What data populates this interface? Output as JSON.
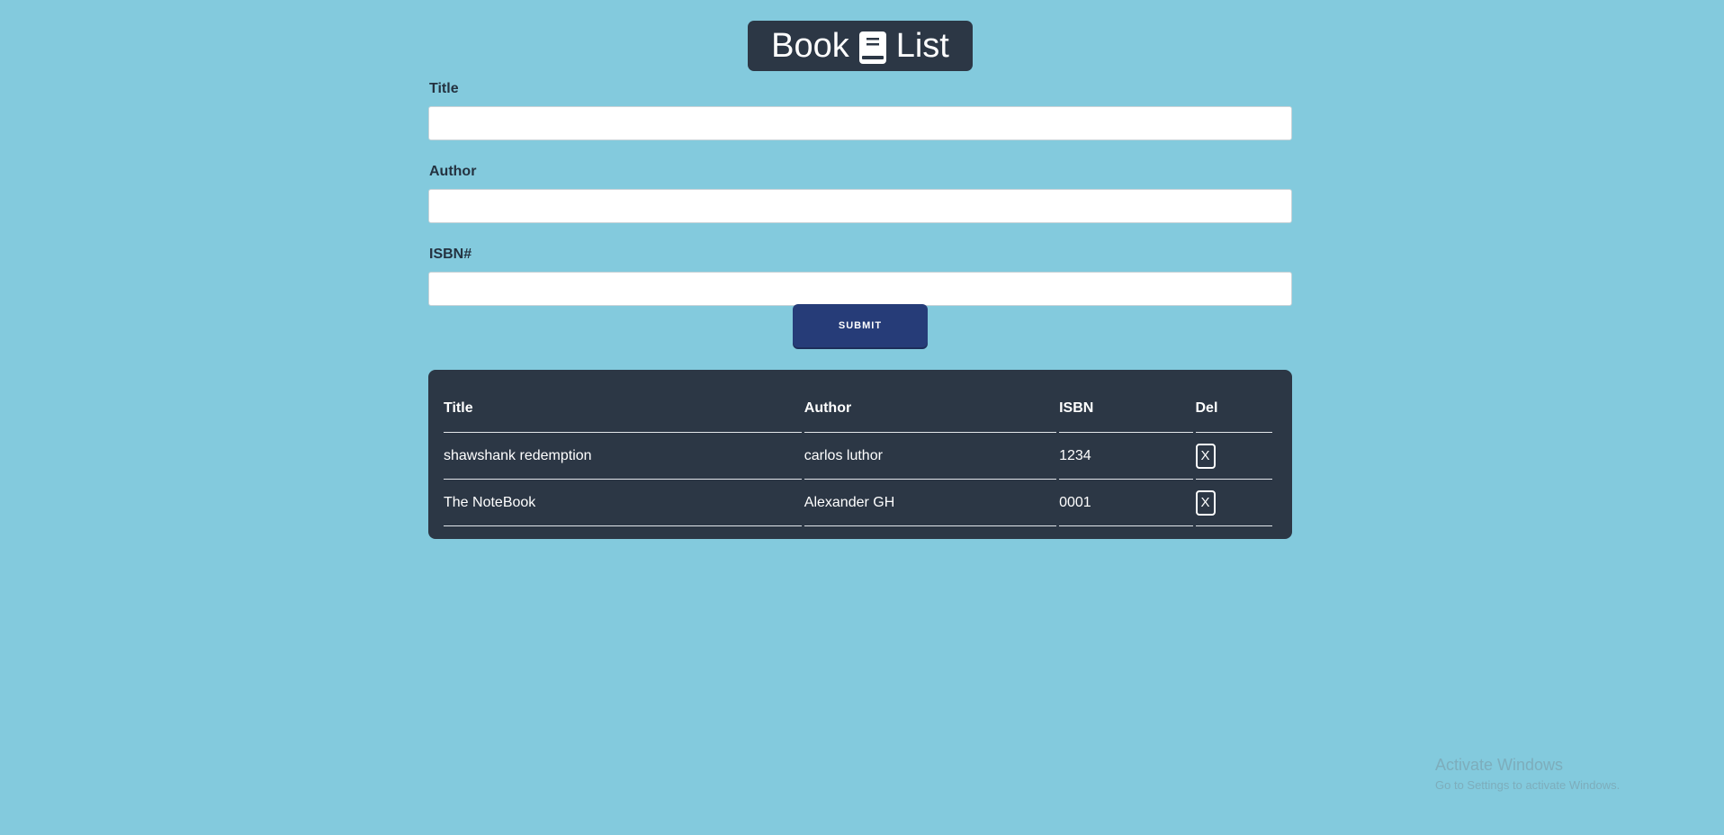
{
  "header": {
    "title_left": "Book",
    "title_right": "List",
    "icon": "book-icon"
  },
  "form": {
    "title_label": "Title",
    "title_value": "",
    "author_label": "Author",
    "author_value": "",
    "isbn_label": "ISBN#",
    "isbn_value": "",
    "submit_label": "SUBMIT"
  },
  "table": {
    "headers": [
      "Title",
      "Author",
      "ISBN",
      "Del"
    ],
    "rows": [
      {
        "title": "shawshank redemption",
        "author": "carlos luthor",
        "isbn": "1234",
        "del": "X"
      },
      {
        "title": "The NoteBook",
        "author": "Alexander GH",
        "isbn": "0001",
        "del": "X"
      }
    ]
  },
  "watermark": {
    "title": "Activate Windows",
    "subtitle": "Go to Settings to activate Windows."
  },
  "colors": {
    "background": "#83cadd",
    "panel": "#2c3745",
    "submit": "#263c78"
  }
}
